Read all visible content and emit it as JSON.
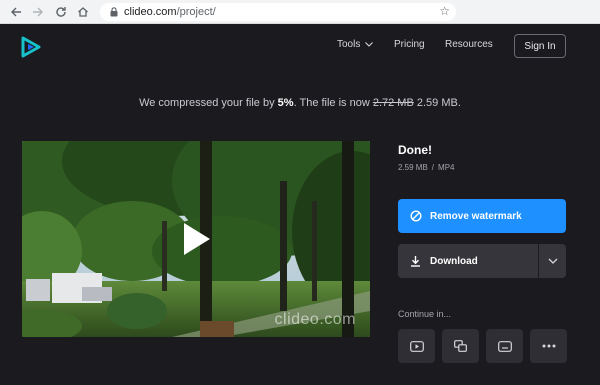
{
  "browser": {
    "url_host": "clideo.com",
    "url_path": "/project/"
  },
  "header": {
    "nav": {
      "tools": "Tools",
      "pricing": "Pricing",
      "resources": "Resources"
    },
    "sign_in": "Sign In"
  },
  "message": {
    "prefix": "We compressed your file by ",
    "percent": "5%",
    "middle": ". The file is now ",
    "old_size": "2.72 MB",
    "new_size": "2.59 MB."
  },
  "video": {
    "watermark": "clideo.com"
  },
  "result": {
    "title": "Done!",
    "size": "2.59 MB",
    "separator": "/",
    "format": "MP4"
  },
  "actions": {
    "remove_watermark": "Remove watermark",
    "download": "Download"
  },
  "continue": {
    "label": "Continue in..."
  },
  "colors": {
    "page_bg": "#1b1b1f",
    "accent": "#1e90ff",
    "button_dark": "#35353b",
    "logo_teal": "#16c1c9",
    "logo_blue": "#1e6fff"
  },
  "icons": [
    "back-icon",
    "forward-icon",
    "reload-icon",
    "home-icon",
    "lock-icon",
    "star-icon",
    "play-icon",
    "no-watermark-icon",
    "download-icon",
    "chevron-down-icon",
    "video-player-icon",
    "merge-icon",
    "subtitles-icon",
    "more-icon"
  ]
}
